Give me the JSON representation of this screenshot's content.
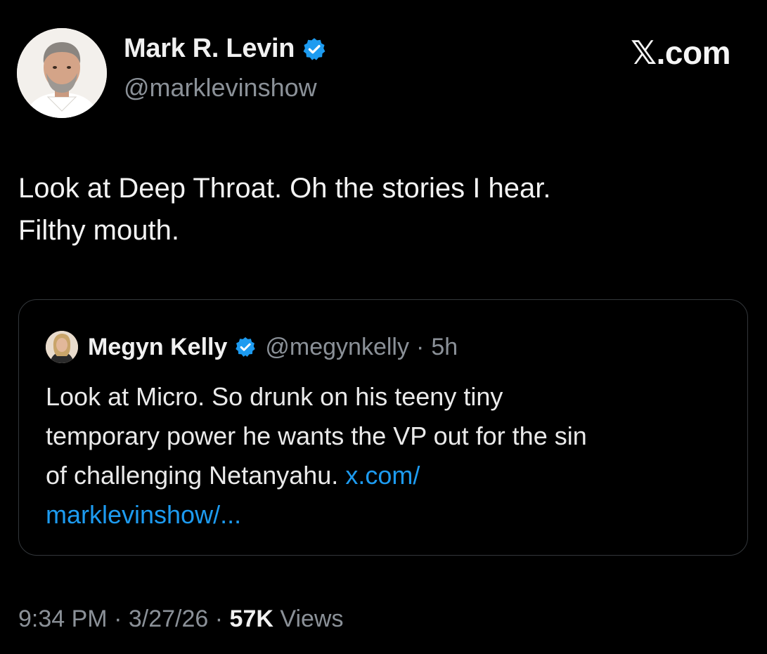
{
  "author": {
    "name": "Mark R. Levin",
    "handle": "@marklevinshow",
    "verified_color": "#1d9bf0"
  },
  "brand": "𝕏.com",
  "tweet": {
    "lines": [
      "Look at Deep Throat. Oh the stories I hear.",
      "Filthy mouth."
    ]
  },
  "quoted_tweet": {
    "name": "Megyn Kelly",
    "handle": "@megynkelly",
    "separator": "·",
    "time": "5h",
    "lines": [
      "Look at Micro. So drunk on his teeny tiny",
      "temporary power he wants the VP out for the sin"
    ],
    "line3_text": "of challenging Netanyahu. ",
    "link_part1": "x.com/",
    "link_part2": "marklevinshow/..."
  },
  "meta": {
    "time": "9:34 PM",
    "separator": "·",
    "date": "3/27/26",
    "views_count": "57K",
    "views_label": "Views"
  },
  "colors": {
    "background": "#000000",
    "text_primary": "#e7e9ea",
    "text_secondary": "#8b9198",
    "link": "#1d9bf0",
    "card_border": "#33373b"
  }
}
